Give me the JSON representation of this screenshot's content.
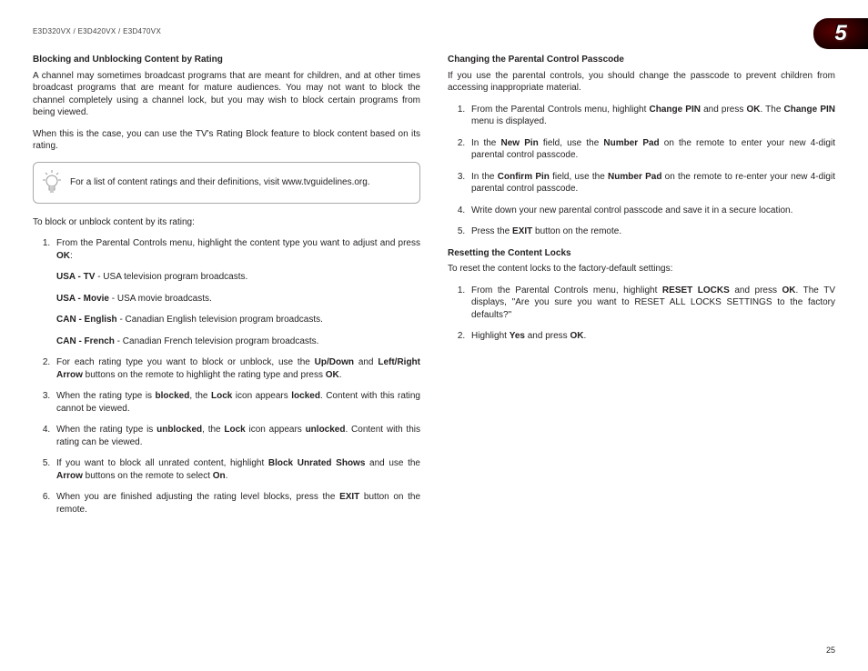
{
  "header": {
    "models": "E3D320VX / E3D420VX / E3D470VX"
  },
  "chapterBadge": {
    "number": "5"
  },
  "left": {
    "h1": "Blocking and Unblocking Content by Rating",
    "p1": "A channel may sometimes broadcast programs that are meant for children, and at other times broadcast programs that are meant for mature audiences. You may not want to block the channel completely using a channel lock, but you may wish to block certain programs from being viewed.",
    "p2": "When this is the case, you can use the TV's Rating Block feature to block content based on its rating.",
    "tip": "For a list of content ratings and their definitions, visit www.tvguidelines.org.",
    "lead": "To block or unblock content by its rating:",
    "step1a": "From the Parental Controls menu, highlight the content type you want to adjust and press ",
    "step1b": ":",
    "types": {
      "t1": {
        "name": "USA - TV",
        "desc": " - USA television program broadcasts."
      },
      "t2": {
        "name": "USA - Movie",
        "desc": " - USA movie broadcasts."
      },
      "t3": {
        "name": "CAN - English",
        "desc": " - Canadian English television program broadcasts."
      },
      "t4": {
        "name": "CAN - French",
        "desc": " - Canadian French television program broadcasts."
      }
    },
    "step2a": "For each rating type you want to block or unblock, use the ",
    "step2b": " and ",
    "step2c": " buttons on the remote to highlight the rating type and press ",
    "step2d": ".",
    "updown": "Up/Down",
    "lrarrow": "Left/Right Arrow",
    "ok": "OK",
    "step3a": "When the rating type is ",
    "step3b": ", the ",
    "step3c": " icon appears ",
    "step3d": ". Content with this rating cannot be viewed.",
    "blocked": "blocked",
    "lock": "Lock",
    "locked": "locked",
    "step4a": "When the rating type is ",
    "step4b": ", the ",
    "step4c": " icon appears ",
    "step4d": ". Content with this rating can be viewed.",
    "unblocked": "unblocked",
    "unlocked": "unlocked",
    "step5a": "If you want to block all unrated content, highlight ",
    "step5b": " and use the ",
    "step5c": " buttons on the remote to select ",
    "step5d": ".",
    "bus": "Block Unrated Shows",
    "arrow": "Arrow",
    "on": "On",
    "step6a": "When you are finished adjusting the rating level blocks, press the ",
    "step6b": " button on the remote.",
    "exit": "EXIT"
  },
  "right": {
    "h1": "Changing the Parental Control Passcode",
    "p1": "If you use the parental controls, you should change the passcode to prevent children from accessing inappropriate material.",
    "s1a": "From the Parental Controls menu, highlight ",
    "s1b": " and press ",
    "s1c": ". The ",
    "s1d": " menu is displayed.",
    "changePin": "Change PIN",
    "ok": "OK",
    "s2a": "In the ",
    "s2b": " field, use the ",
    "s2c": " on the remote to enter your new 4-digit parental control passcode.",
    "newPin": "New Pin",
    "numPad": "Number Pad",
    "s3a": "In the ",
    "s3b": " field, use the ",
    "s3c": " on the remote to re-enter your new 4-digit parental control passcode.",
    "confirmPin": "Confirm Pin",
    "s4": "Write down your new parental control passcode and save it in a secure location.",
    "s5a": "Press the ",
    "s5b": " button on the remote.",
    "exit": "EXIT",
    "h2": "Resetting the Content Locks",
    "p2": "To reset the content locks to the factory-default settings:",
    "r1a": "From the Parental Controls menu, highlight ",
    "r1b": " and press ",
    "r1c": ". The TV displays, \"Are you sure you want to RESET ALL LOCKS SETTINGS to the factory defaults?\"",
    "resetLocks": "RESET LOCKS",
    "r2a": "Highlight ",
    "r2b": " and press ",
    "r2c": ".",
    "yes": "Yes"
  },
  "pageNumber": "25"
}
